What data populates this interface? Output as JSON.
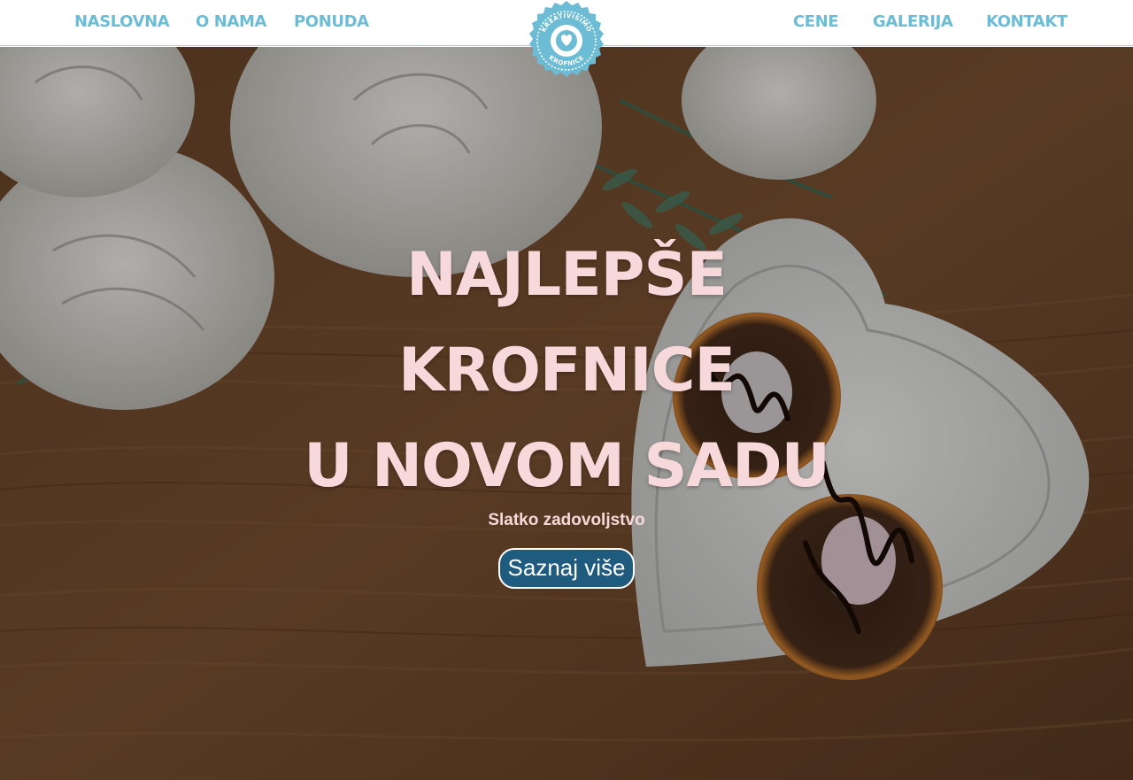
{
  "nav": {
    "left": [
      "NASLOVNA",
      "O NAMA",
      "PONUDA"
    ],
    "right": [
      "CENE",
      "GALERIJA",
      "KONTAKT"
    ]
  },
  "logo": {
    "text_top": "KREATIVISIMO",
    "text_bottom": "KROFNICE",
    "icon": "heart-icon"
  },
  "hero": {
    "title_line1": "NAJLEPŠE KROFNICE",
    "title_line2": "U NOVOM SADU",
    "subtitle": "Slatko zadovoljstvo",
    "button_label": "Saznaj više"
  },
  "colors": {
    "nav_link": "#6dbcd6",
    "title": "#f8d9db",
    "button_bg": "#1f5a7f"
  }
}
